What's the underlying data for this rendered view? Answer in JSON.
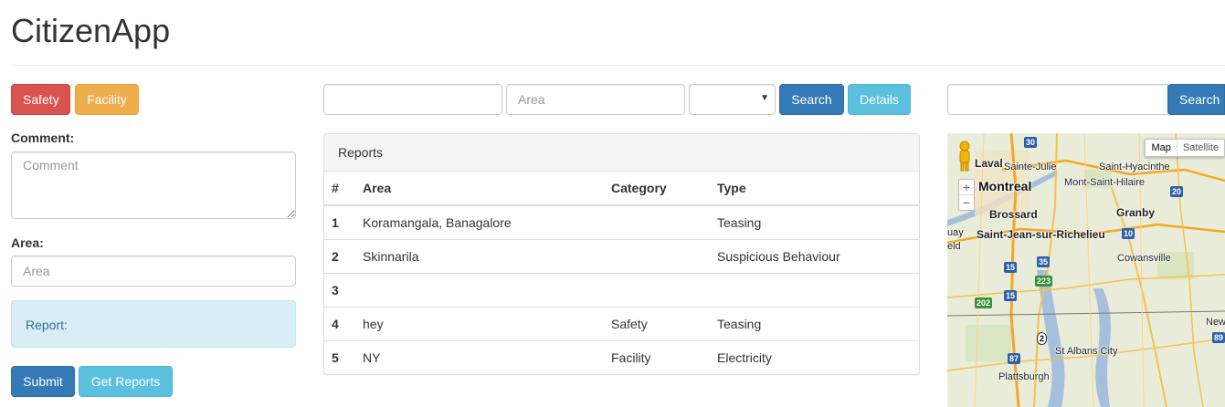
{
  "app": {
    "title": "CitizenApp"
  },
  "category_buttons": {
    "safety": "Safety",
    "facility": "Facility"
  },
  "form": {
    "comment_label": "Comment:",
    "comment_placeholder": "Comment",
    "area_label": "Area:",
    "area_placeholder": "Area",
    "report_text": "Report:",
    "submit_label": "Submit",
    "get_reports_label": "Get Reports"
  },
  "search": {
    "query_value": "",
    "area_placeholder": "Area",
    "select_value": "",
    "search_label": "Search",
    "details_label": "Details"
  },
  "reports": {
    "title": "Reports",
    "columns": [
      "#",
      "Area",
      "Category",
      "Type"
    ],
    "rows": [
      {
        "num": "1",
        "area": "Koramangala, Banagalore",
        "category": "",
        "type": "Teasing"
      },
      {
        "num": "2",
        "area": "Skinnarila",
        "category": "",
        "type": "Suspicious Behaviour"
      },
      {
        "num": "3",
        "area": "",
        "category": "",
        "type": ""
      },
      {
        "num": "4",
        "area": "hey",
        "category": "Safety",
        "type": "Teasing"
      },
      {
        "num": "5",
        "area": "NY",
        "category": "Facility",
        "type": "Electricity"
      }
    ]
  },
  "map": {
    "search_value": "",
    "search_label": "Search",
    "type_map": "Map",
    "type_satellite": "Satellite",
    "zoom_in": "+",
    "zoom_out": "−",
    "places": {
      "laval": "Laval",
      "montreal": "Montreal",
      "sainte_julie": "Sainte-Julie",
      "saint_hyacinthe": "Saint-Hyacinthe",
      "mont_saint_hilaire": "Mont-Saint-Hilaire",
      "brossard": "Brossard",
      "granby": "Granby",
      "saint_jean": "Saint-Jean-sur-Richelieu",
      "cowansville": "Cowansville",
      "st_albans": "St Albans City",
      "plattsburgh": "Plattsburgh",
      "newport": "Newp",
      "guay": "uay",
      "eld": "eld"
    },
    "routes": [
      "30",
      "20",
      "15",
      "35",
      "10",
      "15",
      "223",
      "202",
      "2",
      "87",
      "89"
    ]
  }
}
